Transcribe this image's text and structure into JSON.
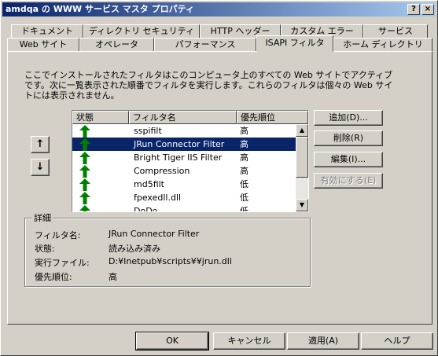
{
  "window": {
    "title": "amdqa の WWW サービス マスタ プロパティ",
    "help_glyph": "?",
    "close_glyph": "×"
  },
  "tabs_row1": [
    {
      "label": "ドキュメント"
    },
    {
      "label": "ディレクトリ セキュリティ"
    },
    {
      "label": "HTTP ヘッダー"
    },
    {
      "label": "カスタム エラー"
    },
    {
      "label": "サービス"
    }
  ],
  "tabs_row2": [
    {
      "label": "Web サイト"
    },
    {
      "label": "オペレータ"
    },
    {
      "label": "パフォーマンス"
    },
    {
      "label": "ISAPI フィルタ",
      "active": true
    },
    {
      "label": "ホーム ディレクトリ"
    }
  ],
  "description": "ここでインストールされたフィルタはこのコンピュータ上のすべての Web サイトでアクティブです。次に一覧表示された順番でフィルタを実行します。これらのフィルタは個々の Web サイトには表示されません。",
  "filter_list": {
    "columns": [
      "状態",
      "フィルタ名",
      "優先順位"
    ],
    "rows": [
      {
        "status": "loaded",
        "name": "sspifilt",
        "priority": "高"
      },
      {
        "status": "loaded",
        "name": "JRun Connector Filter",
        "priority": "高",
        "selected": true
      },
      {
        "status": "loaded",
        "name": "Bright Tiger IIS Filter",
        "priority": "高"
      },
      {
        "status": "loaded",
        "name": "Compression",
        "priority": "高"
      },
      {
        "status": "loaded",
        "name": "md5filt",
        "priority": "低"
      },
      {
        "status": "loaded",
        "name": "fpexedll.dll",
        "priority": "低"
      },
      {
        "status": "loaded",
        "name": "DoDo",
        "priority": "低"
      }
    ],
    "status_color": "#008000",
    "selected_color": "#0a246a"
  },
  "move_buttons": {
    "up": "↑",
    "down": "↓"
  },
  "side_buttons": {
    "add": "追加(D)...",
    "remove": "削除(R)",
    "edit": "編集(I)...",
    "enable": "有効にする(E)"
  },
  "details": {
    "legend": "詳細",
    "name_label": "フィルタ名:",
    "name_value": "JRun Connector Filter",
    "status_label": "状態:",
    "status_value": "読み込み済み",
    "exe_label": "実行ファイル:",
    "exe_value": "D:¥Inetpub¥scripts¥¥jrun.dll",
    "priority_label": "優先順位:",
    "priority_value": "高"
  },
  "footer_buttons": {
    "ok": "OK",
    "cancel": "キャンセル",
    "apply": "適用(A)",
    "help": "ヘルプ"
  }
}
